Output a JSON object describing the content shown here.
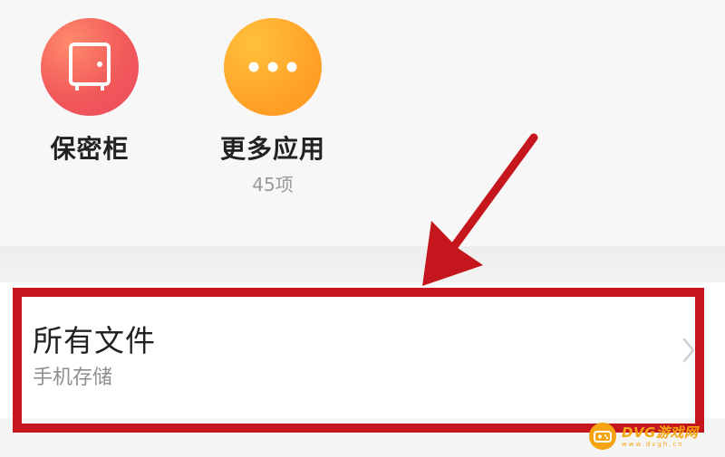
{
  "apps": [
    {
      "label": "保密柜",
      "subtitle": "",
      "icon": "safe-icon",
      "color": "#f25a5a"
    },
    {
      "label": "更多应用",
      "subtitle": "45项",
      "icon": "more-dots-icon",
      "color": "#ffa327"
    }
  ],
  "file_row": {
    "title": "所有文件",
    "subtitle": "手机存储",
    "chevron": "chevron-right-icon"
  },
  "annotation": {
    "color": "#c4161c"
  },
  "watermark": {
    "text": "DVG游戏网",
    "url": "www.dvgh.cn",
    "color": "#f5a511"
  }
}
